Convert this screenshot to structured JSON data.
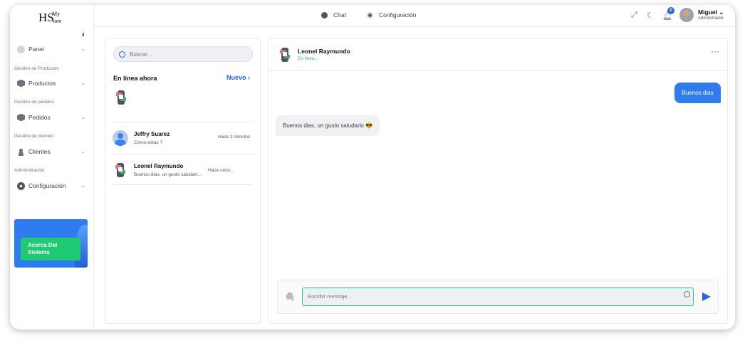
{
  "brand": {
    "logo_left": "HS",
    "logo_top": "My",
    "logo_bottom": "tore"
  },
  "sidebar": {
    "collapse_glyph": "‹",
    "items": [
      {
        "label": "Panel",
        "icon": "dashboard-icon"
      },
      {
        "section": "Gestión de Productos"
      },
      {
        "label": "Productos",
        "icon": "box-icon"
      },
      {
        "section": "Gestión de pedidos"
      },
      {
        "label": "Pedidos",
        "icon": "cube-icon"
      },
      {
        "section": "Gestión de clientes"
      },
      {
        "label": "Clientes",
        "icon": "user-icon"
      },
      {
        "section": "Administración"
      },
      {
        "label": "Configuración",
        "icon": "gear-icon"
      }
    ],
    "promo": {
      "button_line1": "Acerca Del",
      "button_line2": "Sistema"
    }
  },
  "header": {
    "tabs": [
      {
        "label": "Chat",
        "icon": "chat-icon"
      },
      {
        "label": "Configuración",
        "icon": "settings-icon"
      }
    ],
    "notification_count": "0",
    "user": {
      "name": "Miguel",
      "role": "Adminstrador"
    }
  },
  "chat_list": {
    "search_placeholder": "Buscar...",
    "online_title": "En línea ahora",
    "new_label": "Nuevo",
    "conversations": [
      {
        "name": "Jeffry Suarez",
        "message": "Como estas ?",
        "time": "Hace 2 minutos"
      },
      {
        "name": "Leonel Raymundo",
        "message": "Buenos dias, un gusto saludarl...",
        "time": "Hace unos..."
      }
    ]
  },
  "conversation": {
    "contact_name": "Leonel Raymundo",
    "status": "En linea...",
    "messages": [
      {
        "direction": "out",
        "text": "Buenos dias"
      },
      {
        "direction": "in",
        "text": "Buenos dias, un gusto saludarlo 😎"
      }
    ],
    "input_placeholder": "Escribir mensaje..."
  },
  "colors": {
    "accent": "#2f7bf0",
    "success": "#1ecb73",
    "online": "#22c55e"
  }
}
